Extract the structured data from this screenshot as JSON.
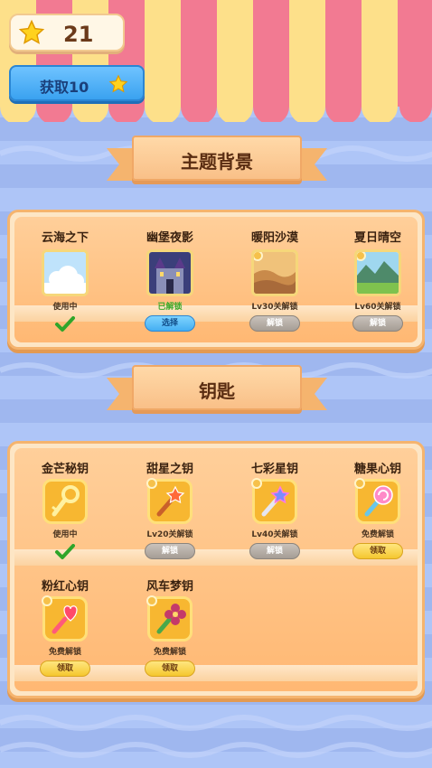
{
  "currency": {
    "stars": "21",
    "get_button_label": "获取10"
  },
  "sections": {
    "themes": {
      "title": "主题背景",
      "items": [
        {
          "name": "云海之下",
          "status": "使用中",
          "action": null
        },
        {
          "name": "幽堡夜影",
          "status": "已解锁",
          "action": "选择"
        },
        {
          "name": "暖阳沙漠",
          "status": "Lv30关解锁",
          "action": "解锁"
        },
        {
          "name": "夏日晴空",
          "status": "Lv60关解锁",
          "action": "解锁"
        }
      ]
    },
    "keys": {
      "title": "钥匙",
      "items": [
        {
          "name": "金芒秘钥",
          "status": "使用中",
          "action": null
        },
        {
          "name": "甜星之钥",
          "status": "Lv20关解锁",
          "action": "解锁"
        },
        {
          "name": "七彩星钥",
          "status": "Lv40关解锁",
          "action": "解锁"
        },
        {
          "name": "糖果心钥",
          "status": "免费解锁",
          "action": "领取"
        },
        {
          "name": "粉红心钥",
          "status": "免费解锁",
          "action": "领取"
        },
        {
          "name": "风车梦钥",
          "status": "免费解锁",
          "action": "领取"
        }
      ]
    }
  },
  "colors": {
    "awning_pink": "#f27a92",
    "awning_yellow": "#fde08a",
    "panel_orange": "#ffb873",
    "accent_blue": "#44aef2",
    "in_use_green": "#3caa2e"
  }
}
